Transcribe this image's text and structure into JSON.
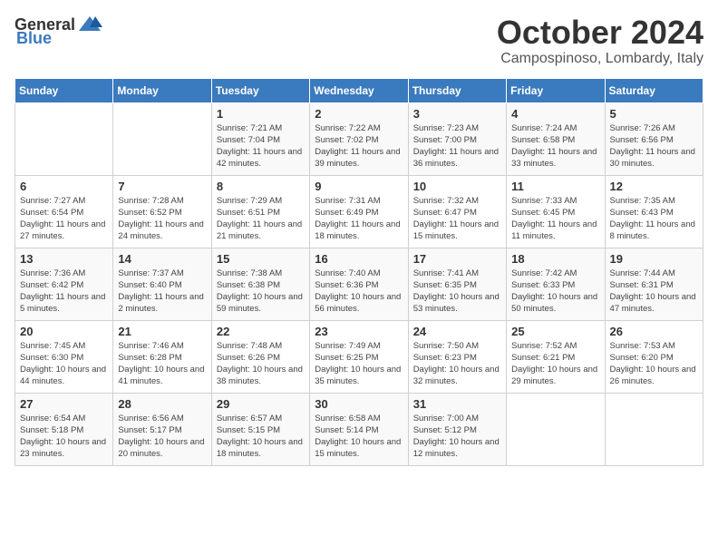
{
  "header": {
    "logo_general": "General",
    "logo_blue": "Blue",
    "month": "October 2024",
    "location": "Campospinoso, Lombardy, Italy"
  },
  "days_of_week": [
    "Sunday",
    "Monday",
    "Tuesday",
    "Wednesday",
    "Thursday",
    "Friday",
    "Saturday"
  ],
  "weeks": [
    [
      {
        "day": "",
        "sunrise": "",
        "sunset": "",
        "daylight": ""
      },
      {
        "day": "",
        "sunrise": "",
        "sunset": "",
        "daylight": ""
      },
      {
        "day": "1",
        "sunrise": "Sunrise: 7:21 AM",
        "sunset": "Sunset: 7:04 PM",
        "daylight": "Daylight: 11 hours and 42 minutes."
      },
      {
        "day": "2",
        "sunrise": "Sunrise: 7:22 AM",
        "sunset": "Sunset: 7:02 PM",
        "daylight": "Daylight: 11 hours and 39 minutes."
      },
      {
        "day": "3",
        "sunrise": "Sunrise: 7:23 AM",
        "sunset": "Sunset: 7:00 PM",
        "daylight": "Daylight: 11 hours and 36 minutes."
      },
      {
        "day": "4",
        "sunrise": "Sunrise: 7:24 AM",
        "sunset": "Sunset: 6:58 PM",
        "daylight": "Daylight: 11 hours and 33 minutes."
      },
      {
        "day": "5",
        "sunrise": "Sunrise: 7:26 AM",
        "sunset": "Sunset: 6:56 PM",
        "daylight": "Daylight: 11 hours and 30 minutes."
      }
    ],
    [
      {
        "day": "6",
        "sunrise": "Sunrise: 7:27 AM",
        "sunset": "Sunset: 6:54 PM",
        "daylight": "Daylight: 11 hours and 27 minutes."
      },
      {
        "day": "7",
        "sunrise": "Sunrise: 7:28 AM",
        "sunset": "Sunset: 6:52 PM",
        "daylight": "Daylight: 11 hours and 24 minutes."
      },
      {
        "day": "8",
        "sunrise": "Sunrise: 7:29 AM",
        "sunset": "Sunset: 6:51 PM",
        "daylight": "Daylight: 11 hours and 21 minutes."
      },
      {
        "day": "9",
        "sunrise": "Sunrise: 7:31 AM",
        "sunset": "Sunset: 6:49 PM",
        "daylight": "Daylight: 11 hours and 18 minutes."
      },
      {
        "day": "10",
        "sunrise": "Sunrise: 7:32 AM",
        "sunset": "Sunset: 6:47 PM",
        "daylight": "Daylight: 11 hours and 15 minutes."
      },
      {
        "day": "11",
        "sunrise": "Sunrise: 7:33 AM",
        "sunset": "Sunset: 6:45 PM",
        "daylight": "Daylight: 11 hours and 11 minutes."
      },
      {
        "day": "12",
        "sunrise": "Sunrise: 7:35 AM",
        "sunset": "Sunset: 6:43 PM",
        "daylight": "Daylight: 11 hours and 8 minutes."
      }
    ],
    [
      {
        "day": "13",
        "sunrise": "Sunrise: 7:36 AM",
        "sunset": "Sunset: 6:42 PM",
        "daylight": "Daylight: 11 hours and 5 minutes."
      },
      {
        "day": "14",
        "sunrise": "Sunrise: 7:37 AM",
        "sunset": "Sunset: 6:40 PM",
        "daylight": "Daylight: 11 hours and 2 minutes."
      },
      {
        "day": "15",
        "sunrise": "Sunrise: 7:38 AM",
        "sunset": "Sunset: 6:38 PM",
        "daylight": "Daylight: 10 hours and 59 minutes."
      },
      {
        "day": "16",
        "sunrise": "Sunrise: 7:40 AM",
        "sunset": "Sunset: 6:36 PM",
        "daylight": "Daylight: 10 hours and 56 minutes."
      },
      {
        "day": "17",
        "sunrise": "Sunrise: 7:41 AM",
        "sunset": "Sunset: 6:35 PM",
        "daylight": "Daylight: 10 hours and 53 minutes."
      },
      {
        "day": "18",
        "sunrise": "Sunrise: 7:42 AM",
        "sunset": "Sunset: 6:33 PM",
        "daylight": "Daylight: 10 hours and 50 minutes."
      },
      {
        "day": "19",
        "sunrise": "Sunrise: 7:44 AM",
        "sunset": "Sunset: 6:31 PM",
        "daylight": "Daylight: 10 hours and 47 minutes."
      }
    ],
    [
      {
        "day": "20",
        "sunrise": "Sunrise: 7:45 AM",
        "sunset": "Sunset: 6:30 PM",
        "daylight": "Daylight: 10 hours and 44 minutes."
      },
      {
        "day": "21",
        "sunrise": "Sunrise: 7:46 AM",
        "sunset": "Sunset: 6:28 PM",
        "daylight": "Daylight: 10 hours and 41 minutes."
      },
      {
        "day": "22",
        "sunrise": "Sunrise: 7:48 AM",
        "sunset": "Sunset: 6:26 PM",
        "daylight": "Daylight: 10 hours and 38 minutes."
      },
      {
        "day": "23",
        "sunrise": "Sunrise: 7:49 AM",
        "sunset": "Sunset: 6:25 PM",
        "daylight": "Daylight: 10 hours and 35 minutes."
      },
      {
        "day": "24",
        "sunrise": "Sunrise: 7:50 AM",
        "sunset": "Sunset: 6:23 PM",
        "daylight": "Daylight: 10 hours and 32 minutes."
      },
      {
        "day": "25",
        "sunrise": "Sunrise: 7:52 AM",
        "sunset": "Sunset: 6:21 PM",
        "daylight": "Daylight: 10 hours and 29 minutes."
      },
      {
        "day": "26",
        "sunrise": "Sunrise: 7:53 AM",
        "sunset": "Sunset: 6:20 PM",
        "daylight": "Daylight: 10 hours and 26 minutes."
      }
    ],
    [
      {
        "day": "27",
        "sunrise": "Sunrise: 6:54 AM",
        "sunset": "Sunset: 5:18 PM",
        "daylight": "Daylight: 10 hours and 23 minutes."
      },
      {
        "day": "28",
        "sunrise": "Sunrise: 6:56 AM",
        "sunset": "Sunset: 5:17 PM",
        "daylight": "Daylight: 10 hours and 20 minutes."
      },
      {
        "day": "29",
        "sunrise": "Sunrise: 6:57 AM",
        "sunset": "Sunset: 5:15 PM",
        "daylight": "Daylight: 10 hours and 18 minutes."
      },
      {
        "day": "30",
        "sunrise": "Sunrise: 6:58 AM",
        "sunset": "Sunset: 5:14 PM",
        "daylight": "Daylight: 10 hours and 15 minutes."
      },
      {
        "day": "31",
        "sunrise": "Sunrise: 7:00 AM",
        "sunset": "Sunset: 5:12 PM",
        "daylight": "Daylight: 10 hours and 12 minutes."
      },
      {
        "day": "",
        "sunrise": "",
        "sunset": "",
        "daylight": ""
      },
      {
        "day": "",
        "sunrise": "",
        "sunset": "",
        "daylight": ""
      }
    ]
  ]
}
